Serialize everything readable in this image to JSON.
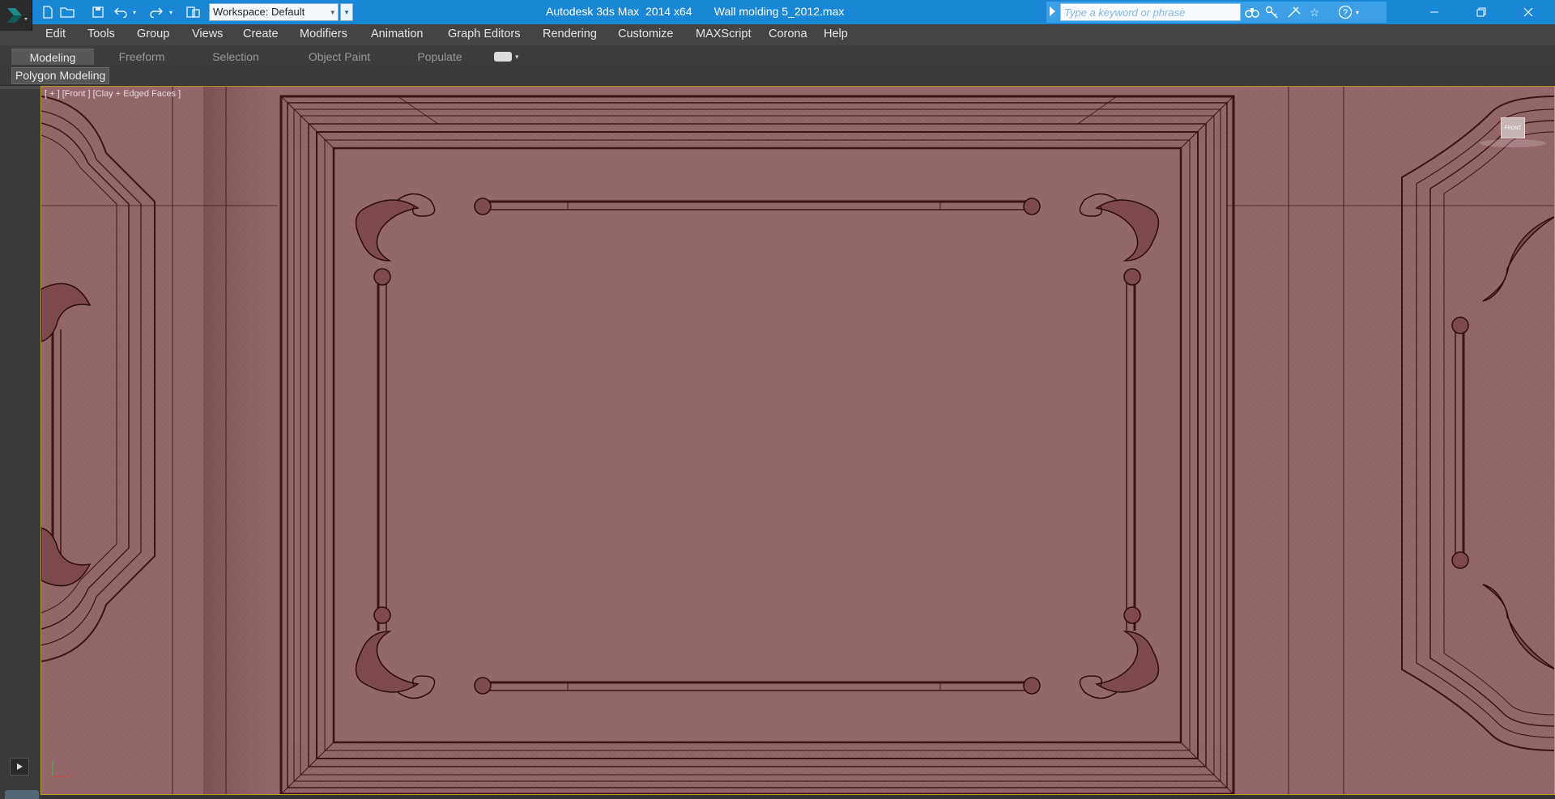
{
  "titlebar": {
    "app_title": "Autodesk 3ds Max  2014 x64",
    "file_name": "Wall molding 5_2012.max",
    "workspace_label": "Workspace: Default",
    "search_placeholder": "Type a keyword or phrase",
    "color": "#1a87d6"
  },
  "quick_access": {
    "icons": [
      "new-file-icon",
      "open-file-icon",
      "save-icon",
      "undo-icon",
      "redo-icon",
      "project-folder-icon"
    ]
  },
  "menu": {
    "items": [
      "Edit",
      "Tools",
      "Group",
      "Views",
      "Create",
      "Modifiers",
      "Animation",
      "Graph Editors",
      "Rendering",
      "Customize",
      "MAXScript",
      "Corona",
      "Help"
    ]
  },
  "ribbon": {
    "tabs": [
      "Modeling",
      "Freeform",
      "Selection",
      "Object Paint",
      "Populate"
    ],
    "active_tab": "Modeling",
    "panel_label": "Polygon Modeling"
  },
  "viewport": {
    "label": "[ + ] [Front ] [Clay + Edged Faces ]",
    "viewcube_label": "FRONT",
    "background_color": "#94686b"
  }
}
